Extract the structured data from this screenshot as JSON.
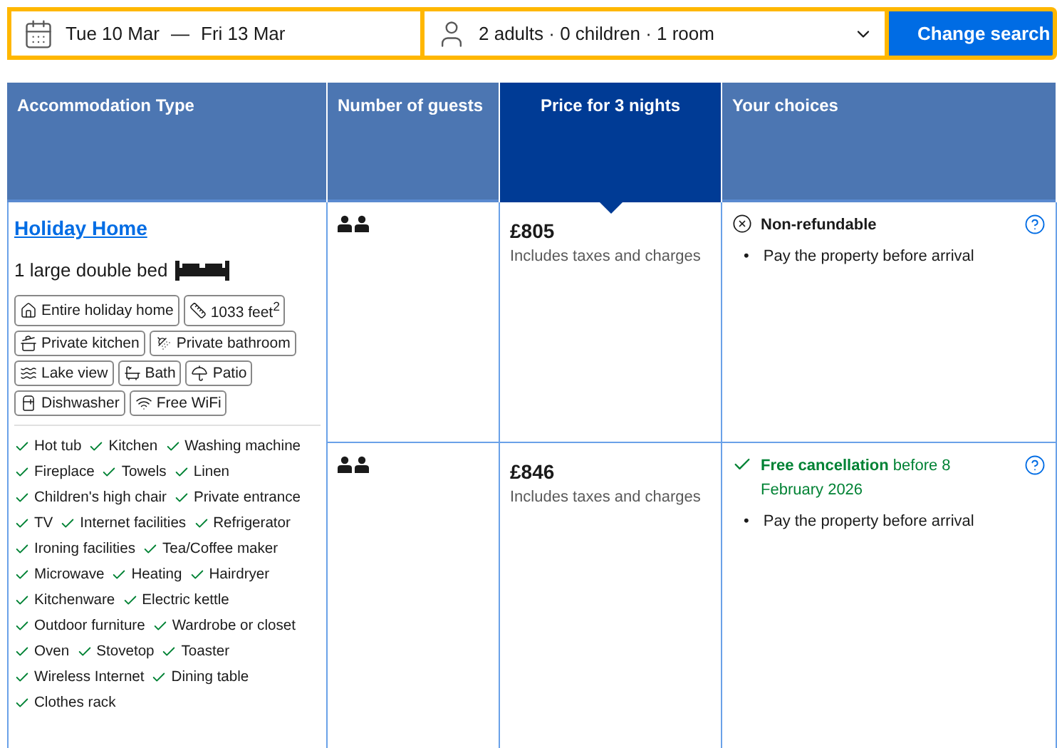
{
  "search": {
    "checkin": "Tue 10 Mar",
    "separator": "—",
    "checkout": "Fri 13 Mar",
    "guests": "2 adults · 0 children · 1 room",
    "button": "Change search"
  },
  "columns": [
    {
      "label": "Accommodation Type",
      "selected": false
    },
    {
      "label": "Number of guests",
      "selected": false
    },
    {
      "label": "Price for 3 nights",
      "selected": true
    },
    {
      "label": "Your choices",
      "selected": false
    }
  ],
  "accommodation": {
    "name": "Holiday Home",
    "bed": "1 large double bed",
    "facilities": [
      {
        "label": "Entire holiday home",
        "kind": "home"
      },
      {
        "label": "1033 feet$^{2}$",
        "kind": "area"
      },
      {
        "label": "Private kitchen",
        "kind": "kitchen"
      },
      {
        "label": "Private bathroom",
        "kind": "shower"
      },
      {
        "label": "Lake view",
        "kind": "lake"
      },
      {
        "label": "Bath",
        "kind": "bath"
      },
      {
        "label": "Patio",
        "kind": "patio"
      },
      {
        "label": "Dishwasher",
        "kind": "dishwasher"
      },
      {
        "label": "Free WiFi",
        "kind": "wifi"
      }
    ],
    "amenities": [
      "Hot tub",
      "Kitchen",
      "Washing machine",
      "Fireplace",
      "Towels",
      "Linen",
      "Children's high chair",
      "Private entrance",
      "TV",
      "Internet facilities",
      "Refrigerator",
      "Ironing facilities",
      "Tea/Coffee maker",
      "Microwave",
      "Heating",
      "Hairdryer",
      "Kitchenware",
      "Electric kettle",
      "Outdoor furniture",
      "Wardrobe or closet",
      "Oven",
      "Stovetop",
      "Toaster",
      "Wireless Internet",
      "Dining table",
      "Clothes rack"
    ]
  },
  "rows": [
    {
      "price": "£805",
      "note": "Includes taxes and charges",
      "policy": {
        "kind": "non-refundable",
        "text": "Non-refundable"
      },
      "bullets": [
        {
          "marker": "•",
          "text": "Pay the property before arrival"
        }
      ]
    },
    {
      "price": "£846",
      "note": "Includes taxes and charges",
      "policy": {
        "kind": "free-cancellation",
        "text": "**Free cancellation** before 8 February 2026"
      },
      "bullets": [
        {
          "marker": "•",
          "text": "Pay the property before arrival"
        }
      ]
    }
  ]
}
